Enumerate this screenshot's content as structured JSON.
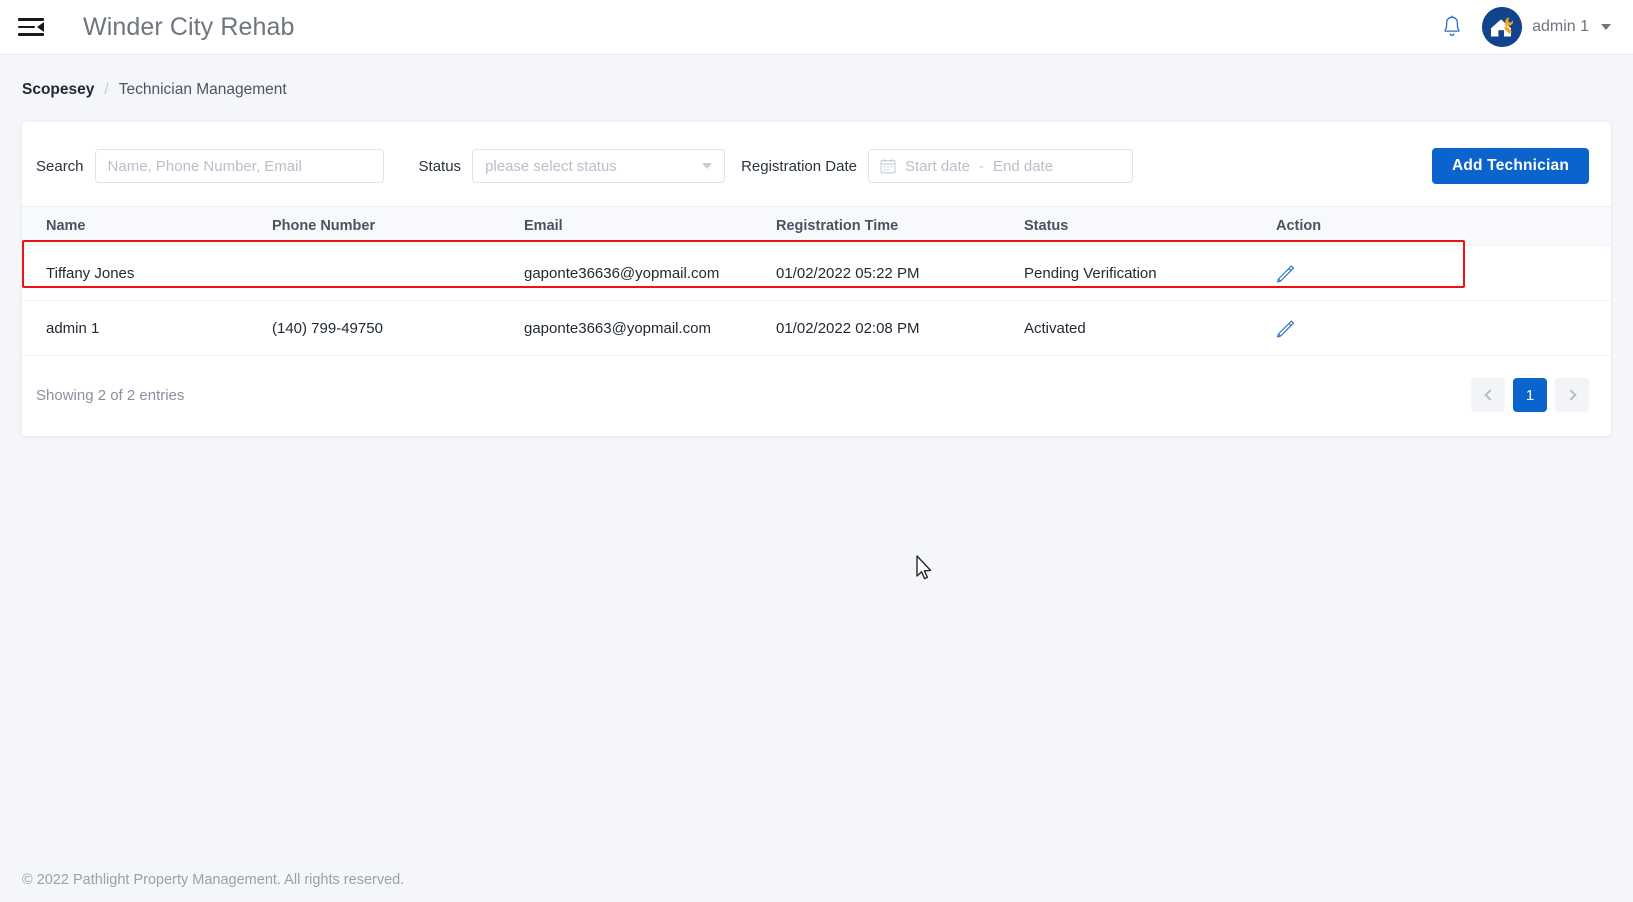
{
  "topbar": {
    "menu_icon": "hamburger-collapse-icon",
    "app_title": "Winder City Rehab",
    "bell_icon": "bell-icon",
    "avatar_icon": "house-wrench-avatar",
    "user_name": "admin 1",
    "caret_icon": "chevron-down-icon"
  },
  "breadcrumb": {
    "root": "Scopesey",
    "separator": "/",
    "current": "Technician Management"
  },
  "filters": {
    "search_label": "Search",
    "search_placeholder": "Name, Phone Number, Email",
    "search_value": "",
    "status_label": "Status",
    "status_placeholder": "please select status",
    "status_value": "",
    "regdate_label": "Registration Date",
    "calendar_icon": "calendar-icon",
    "start_date_placeholder": "Start date",
    "end_date_placeholder": "End date",
    "date_separator": "-",
    "add_button": "Add Technician"
  },
  "table": {
    "columns": [
      "Name",
      "Phone Number",
      "Email",
      "Registration Time",
      "Status",
      "Action"
    ],
    "rows": [
      {
        "name": "Tiffany Jones",
        "phone": "",
        "email": "gaponte36636@yopmail.com",
        "registration_time": "01/02/2022 05:22 PM",
        "status": "Pending Verification",
        "action_icon": "edit-pencil-icon",
        "highlighted": true
      },
      {
        "name": "admin 1",
        "phone": "(140) 799-49750",
        "email": "gaponte3663@yopmail.com",
        "registration_time": "01/02/2022 02:08 PM",
        "status": "Activated",
        "action_icon": "edit-pencil-icon",
        "highlighted": false
      }
    ]
  },
  "pagination": {
    "entries_text": "Showing 2 of 2 entries",
    "prev_icon": "chevron-left-icon",
    "next_icon": "chevron-right-icon",
    "current_page": "1"
  },
  "footer": {
    "copyright": "© 2022 Pathlight Property Management. All rights reserved."
  },
  "colors": {
    "accent_blue": "#0b64cc",
    "highlight_red": "#f01212",
    "page_bg": "#f4f6fa",
    "avatar_bg": "#11448c",
    "wrench_orange": "#f5a623"
  }
}
